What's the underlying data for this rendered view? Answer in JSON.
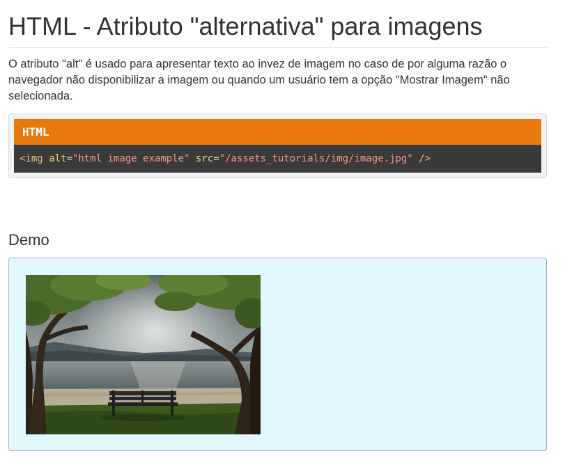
{
  "page": {
    "title": "HTML - Atributo \"alternativa\" para imagens",
    "intro": "O atributo \"alt\" é usado para apresentar texto ao invez de imagem no caso de por alguma razão o navegador não disponibilizar a imagem ou quando um usuário tem a opção \"Mostrar Imagem\" não selecionada."
  },
  "code": {
    "header": "HTML",
    "tag_open": "<img",
    "attr1_name": "alt",
    "attr1_value": "\"html image example\"",
    "attr2_name": "src",
    "attr2_value": "\"/assets_tutorials/img/image.jpg\"",
    "tag_close": "/>"
  },
  "demo": {
    "heading": "Demo"
  },
  "colors": {
    "code_header_bg": "#e8790e",
    "code_body_bg": "#3a3a3a",
    "demo_bg": "#e1f7fd"
  }
}
